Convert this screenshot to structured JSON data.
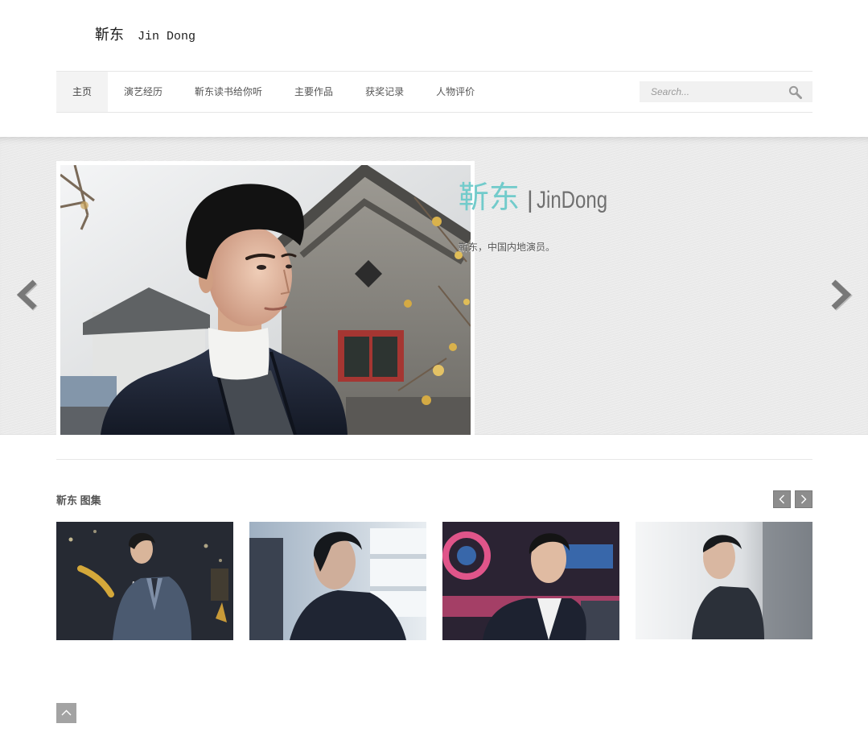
{
  "site": {
    "title_cn": "靳东",
    "title_en": "Jin Dong"
  },
  "nav": {
    "items": [
      {
        "label": "主页",
        "active": true
      },
      {
        "label": "演艺经历",
        "active": false
      },
      {
        "label": "靳东读书给你听",
        "active": false
      },
      {
        "label": "主要作品",
        "active": false
      },
      {
        "label": "获奖记录",
        "active": false
      },
      {
        "label": "人物评价",
        "active": false
      }
    ]
  },
  "search": {
    "placeholder": "Search...",
    "icon": "search-icon"
  },
  "slider": {
    "title_cn": "靳东",
    "separator": "|",
    "title_en": "JinDong",
    "description": "靳东，中国内地演员。",
    "prev_icon": "chevron-left-icon",
    "next_icon": "chevron-right-icon"
  },
  "gallery": {
    "title": "靳东 图集",
    "prev_icon": "chevron-left-icon",
    "next_icon": "chevron-right-icon"
  },
  "back_to_top": {
    "icon": "chevron-up-icon"
  },
  "colors": {
    "accent": "#72cbcb",
    "nav_active_bg": "#f3f3f3",
    "control_gray": "#8d8d8d"
  }
}
